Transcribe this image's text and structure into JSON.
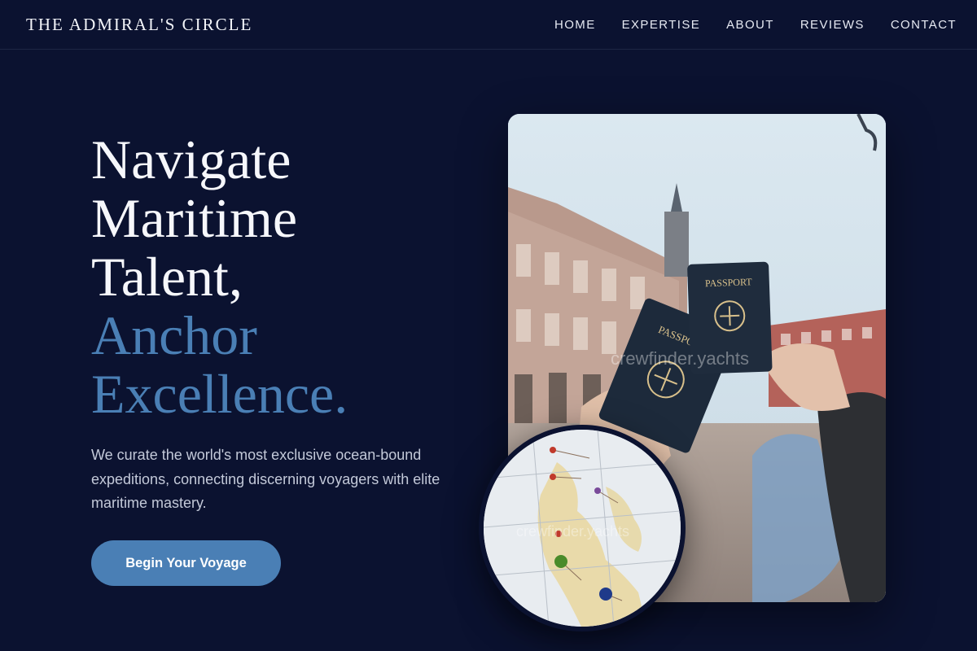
{
  "nav": {
    "brand": "THE ADMIRAL'S CIRCLE",
    "links": [
      "HOME",
      "EXPERTISE",
      "ABOUT",
      "REVIEWS",
      "CONTACT"
    ]
  },
  "hero": {
    "headline_lines": [
      "Navigate",
      "Maritime",
      "Talent,"
    ],
    "headline_accent_lines": [
      "Anchor",
      "Excellence."
    ],
    "subtext": "We curate the world's most exclusive ocean-bound expeditions, connecting discerning voyagers with elite maritime mastery.",
    "cta_label": "Begin Your Voyage"
  },
  "photo": {
    "watermark": "crewfinder.yachts",
    "passport_label_1": "PASSPORT",
    "passport_label_2": "PASSPORT"
  },
  "map": {
    "watermark": "crewfinder.yachts"
  },
  "colors": {
    "background": "#0b1230",
    "accent": "#4a7fb5",
    "text": "#f6f7fb",
    "muted_text": "#c3c9d9"
  }
}
